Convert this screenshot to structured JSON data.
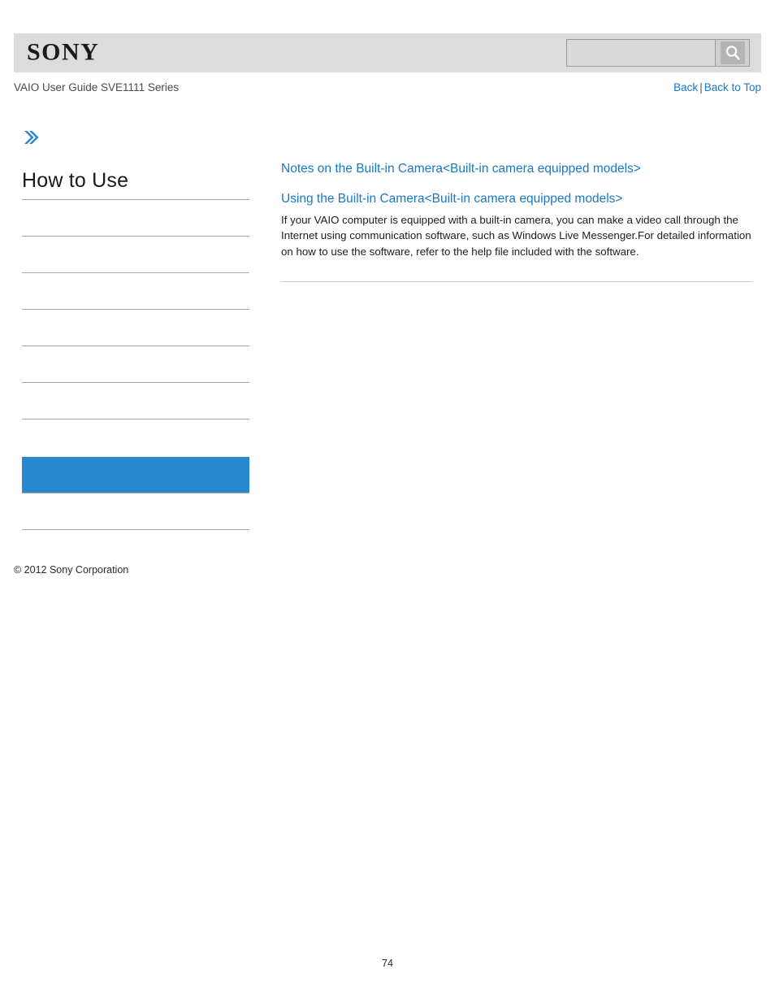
{
  "header": {
    "logo_text": "SONY",
    "search": {
      "value": "",
      "placeholder": "",
      "icon": "search-icon"
    }
  },
  "subheader": {
    "guide_title": "VAIO User Guide SVE1111 Series",
    "back_label": "Back",
    "separator": "|",
    "back_to_top_label": "Back to Top"
  },
  "sidebar": {
    "back_arrow_icon": "chevron-right-icon",
    "title": "How to Use",
    "active_color": "#2989ce",
    "items": [
      {
        "label": ""
      },
      {
        "label": ""
      },
      {
        "label": ""
      },
      {
        "label": ""
      },
      {
        "label": ""
      },
      {
        "label": ""
      },
      {
        "label": ""
      },
      {
        "label": "",
        "active": true
      },
      {
        "label": ""
      }
    ]
  },
  "content": {
    "links": [
      "Notes on the Built-in Camera<Built-in camera equipped models>",
      "Using the Built-in Camera<Built-in camera equipped models>"
    ],
    "paragraph": "If your VAIO computer is equipped with a built-in camera, you can make a video call through the Internet using communication software, such as Windows Live Messenger.For detailed information on how to use the software, refer to the help file included with the software."
  },
  "footer": {
    "copyright": "© 2012 Sony Corporation",
    "page_number": "74"
  },
  "colors": {
    "link": "#1878c8",
    "header_bar": "#dcdcdc",
    "accent": "#2989ce"
  }
}
